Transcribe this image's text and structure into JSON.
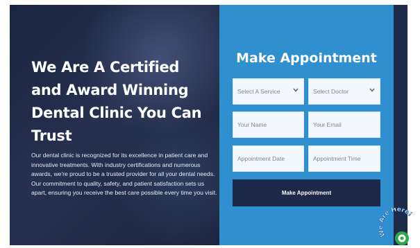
{
  "hero": {
    "title": "We Are A Certified and Award Winning Dental Clinic You Can Trust",
    "description": "Our dental clinic is recognized for its excellence in patient care and innovative treatments. With industry certifications and numerous awards, we're proud to be a trusted provider for all your dental needs. Our commitment to quality, safety, and patient satisfaction sets us apart, ensuring you receive the best care possible every time you visit."
  },
  "form": {
    "title": "Make Appointment",
    "service_select": "Select A Service",
    "doctor_select": "Select Doctor",
    "name_placeholder": "Your Name",
    "email_placeholder": "Your Email",
    "date_placeholder": "Appointment Date",
    "time_placeholder": "Appointment Time",
    "submit_label": "Make Appointment"
  },
  "badge": {
    "text": "We Are Here!"
  },
  "colors": {
    "hero_bg": "#1f2a45",
    "form_bg": "#2f8fcf",
    "button_bg": "#1c2949",
    "field_bg": "#f2f8fe"
  },
  "icons": [
    "chevron-down-icon",
    "badge-icon"
  ]
}
